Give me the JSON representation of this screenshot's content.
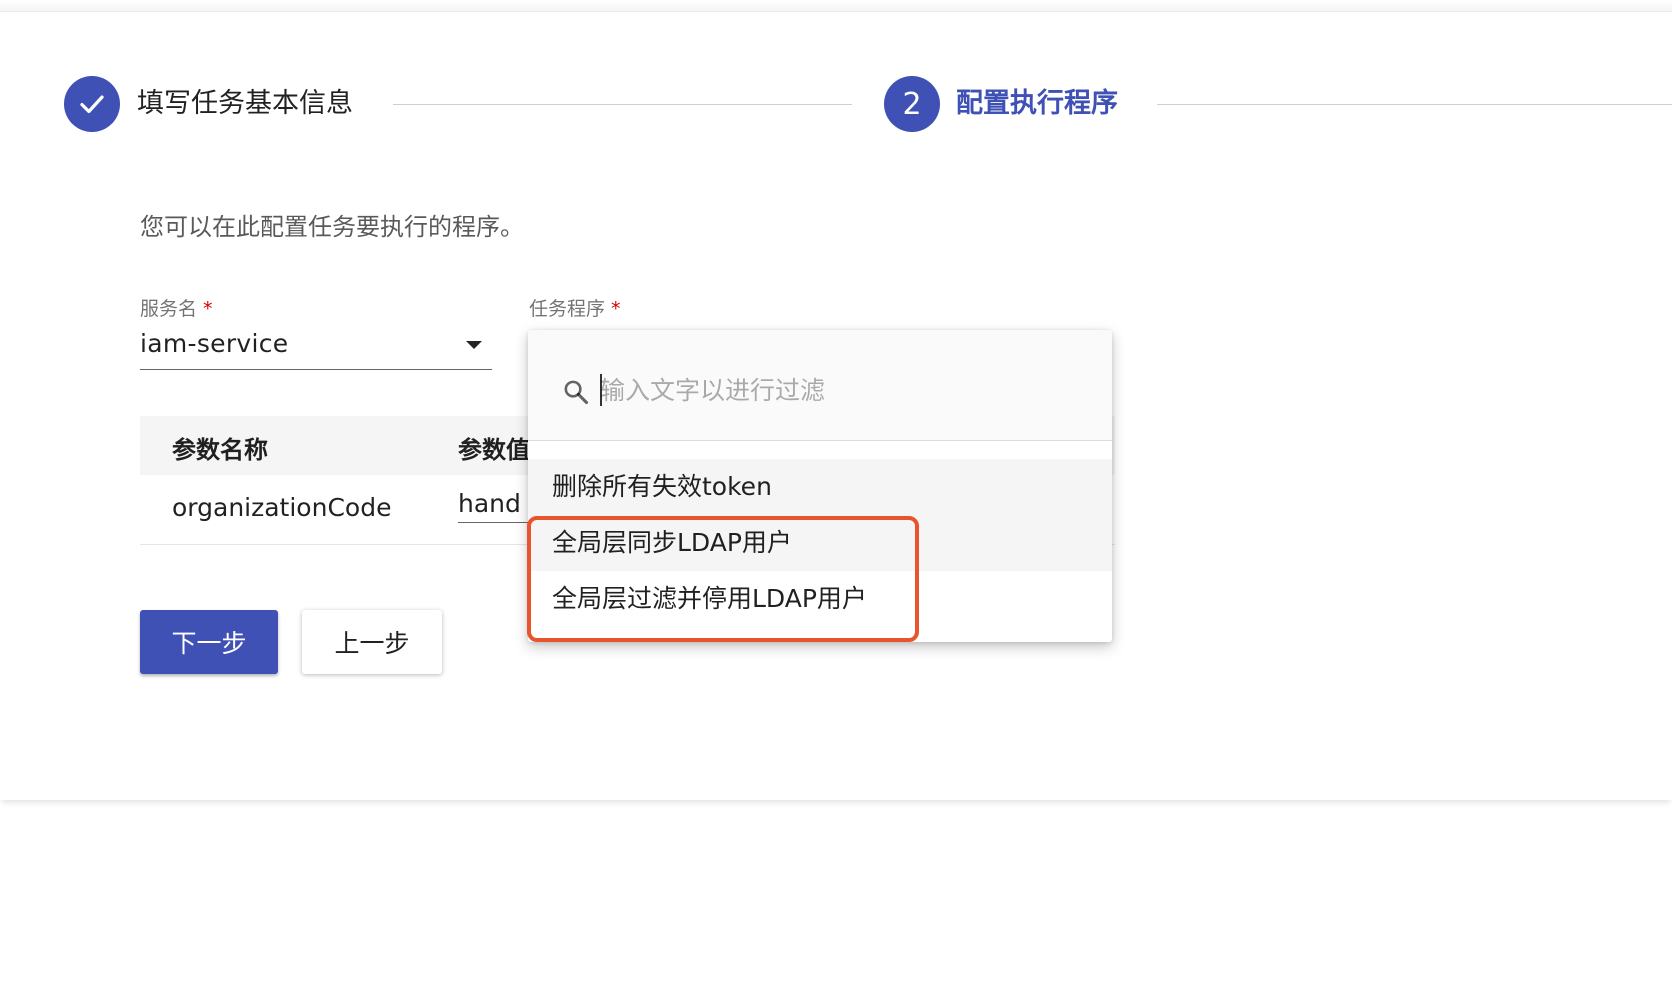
{
  "stepper": {
    "step1": {
      "icon": "check-icon",
      "label": "填写任务基本信息",
      "state": "completed"
    },
    "step2": {
      "number": "2",
      "label": "配置执行程序",
      "state": "active"
    }
  },
  "description": "您可以在此配置任务要执行的程序。",
  "service_field": {
    "label": "服务名",
    "required_mark": "*",
    "value": "iam-service"
  },
  "program_field": {
    "label": "任务程序",
    "required_mark": "*"
  },
  "table": {
    "headers": [
      "参数名称",
      "参数值"
    ],
    "rows": [
      {
        "name": "organizationCode",
        "value": "hand"
      }
    ]
  },
  "buttons": {
    "next": "下一步",
    "previous": "上一步"
  },
  "dropdown": {
    "search_placeholder": "输入文字以进行过滤",
    "options": [
      "删除所有失效token",
      "全局层同步LDAP用户",
      "全局层过滤并停用LDAP用户"
    ]
  },
  "colors": {
    "primary": "#3f51b5",
    "required": "#d50000",
    "highlight": "#e8542e"
  }
}
